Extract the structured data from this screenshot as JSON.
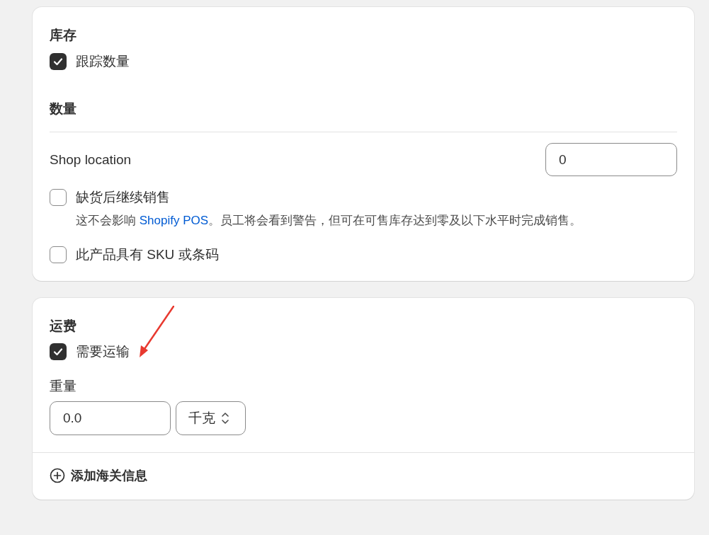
{
  "inventory": {
    "title": "库存",
    "track_quantity": {
      "label": "跟踪数量",
      "checked": true
    },
    "quantity_title": "数量",
    "locations": [
      {
        "name": "Shop location",
        "value": "0"
      }
    ],
    "options": [
      {
        "label": "缺货后继续销售",
        "checked": false,
        "help_before": "这不会影响 ",
        "help_link": "Shopify POS",
        "help_after": "。员工将会看到警告，但可在可售库存达到零及以下水平时完成销售。"
      },
      {
        "label": "此产品具有 SKU 或条码",
        "checked": false
      }
    ]
  },
  "shipping": {
    "title": "运费",
    "requires_shipping": {
      "label": "需要运输",
      "checked": true
    },
    "weight_label": "重量",
    "weight_value": "0.0",
    "weight_unit": "千克",
    "footer_action": "添加海关信息"
  }
}
